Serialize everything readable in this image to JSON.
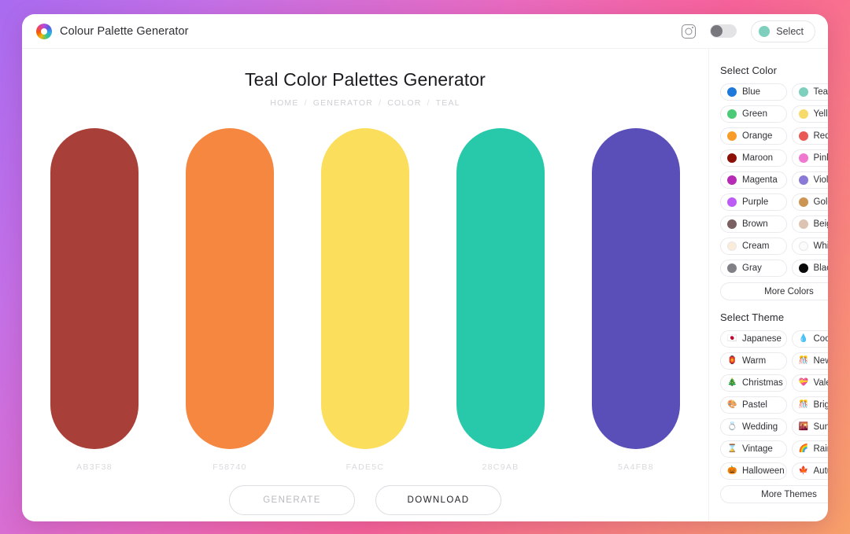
{
  "page": {
    "background_gradient_from": "#a96bf0",
    "background_gradient_to": "#f7a06a"
  },
  "header": {
    "logo_icon": "color-wheel-ring-icon",
    "brand_title": "Colour Palette Generator",
    "instagram_icon": "instagram-camera-icon",
    "toggle_state": "off",
    "select_button": {
      "label": "Select",
      "dot_color": "#7ecfbd"
    }
  },
  "main": {
    "title": "Teal Color Palettes Generator",
    "breadcrumb": [
      "HOME",
      "GENERATOR",
      "COLOR",
      "TEAL"
    ],
    "breadcrumb_separator": "/",
    "swatches": [
      {
        "hex_label": "AB3F38",
        "color": "#a83f38"
      },
      {
        "hex_label": "F58740",
        "color": "#f58740"
      },
      {
        "hex_label": "FADE5C",
        "color": "#fade5c"
      },
      {
        "hex_label": "28C9AB",
        "color": "#28c9ab"
      },
      {
        "hex_label": "5A4FB8",
        "color": "#5a4fb8"
      }
    ],
    "actions": {
      "generate_label": "GENERATE",
      "download_label": "DOWNLOAD"
    }
  },
  "sidebar": {
    "color_section": {
      "heading": "Select Color",
      "items": [
        {
          "label": "Blue",
          "color": "#1f79d9"
        },
        {
          "label": "Teal",
          "color": "#7ecfbd"
        },
        {
          "label": "Green",
          "color": "#4cca77"
        },
        {
          "label": "Yellow",
          "color": "#f7db6a"
        },
        {
          "label": "Orange",
          "color": "#f79c29"
        },
        {
          "label": "Red",
          "color": "#ea5a55"
        },
        {
          "label": "Maroon",
          "color": "#8a1008"
        },
        {
          "label": "Pink",
          "color": "#f078cf"
        },
        {
          "label": "Magenta",
          "color": "#b52bb5"
        },
        {
          "label": "Violet",
          "color": "#8b79d8"
        },
        {
          "label": "Purple",
          "color": "#bd5cf5"
        },
        {
          "label": "Gold",
          "color": "#cc9553"
        },
        {
          "label": "Brown",
          "color": "#7a6060"
        },
        {
          "label": "Beige",
          "color": "#ddc4b2"
        },
        {
          "label": "Cream",
          "color": "#fbecd9"
        },
        {
          "label": "White",
          "color": "#fbfbfb"
        },
        {
          "label": "Gray",
          "color": "#808086"
        },
        {
          "label": "Black",
          "color": "#0a0a0a"
        }
      ],
      "more_label": "More Colors"
    },
    "theme_section": {
      "heading": "Select Theme",
      "items": [
        {
          "label": "Japanese",
          "emoji": "🇯🇵",
          "icon_name": "japan-flag-icon"
        },
        {
          "label": "Cool",
          "emoji": "💧",
          "icon_name": "water-drop-icon"
        },
        {
          "label": "Warm",
          "emoji": "🏮",
          "icon_name": "lantern-icon"
        },
        {
          "label": "New-Year",
          "emoji": "🎊",
          "icon_name": "party-popper-icon"
        },
        {
          "label": "Christmas",
          "emoji": "🎄",
          "icon_name": "christmas-tree-icon"
        },
        {
          "label": "Valentine",
          "emoji": "💝",
          "icon_name": "heart-ribbon-icon"
        },
        {
          "label": "Pastel",
          "emoji": "🎨",
          "icon_name": "artist-palette-icon"
        },
        {
          "label": "Bright",
          "emoji": "🎊",
          "icon_name": "confetti-ball-icon"
        },
        {
          "label": "Wedding",
          "emoji": "💍",
          "icon_name": "ring-icon"
        },
        {
          "label": "Sunset",
          "emoji": "🌇",
          "icon_name": "sunset-city-icon"
        },
        {
          "label": "Vintage",
          "emoji": "⌛",
          "icon_name": "hourglass-icon"
        },
        {
          "label": "Rainbow",
          "emoji": "🌈",
          "icon_name": "rainbow-icon"
        },
        {
          "label": "Halloween",
          "emoji": "🎃",
          "icon_name": "jack-o-lantern-icon"
        },
        {
          "label": "Autumn",
          "emoji": "🍁",
          "icon_name": "maple-leaf-icon"
        }
      ],
      "more_label": "More Themes"
    }
  }
}
